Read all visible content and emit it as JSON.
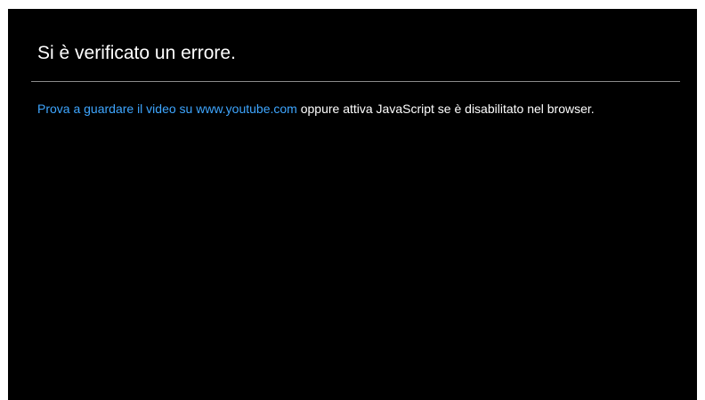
{
  "error": {
    "title": "Si è verificato un errore.",
    "link_text": "Prova a guardare il video su www.youtube.com",
    "message_rest": " oppure attiva JavaScript se è disabilitato nel browser."
  },
  "colors": {
    "background": "#000000",
    "text": "#ffffff",
    "link": "#3ea6ff",
    "divider": "#8a8a8a"
  }
}
